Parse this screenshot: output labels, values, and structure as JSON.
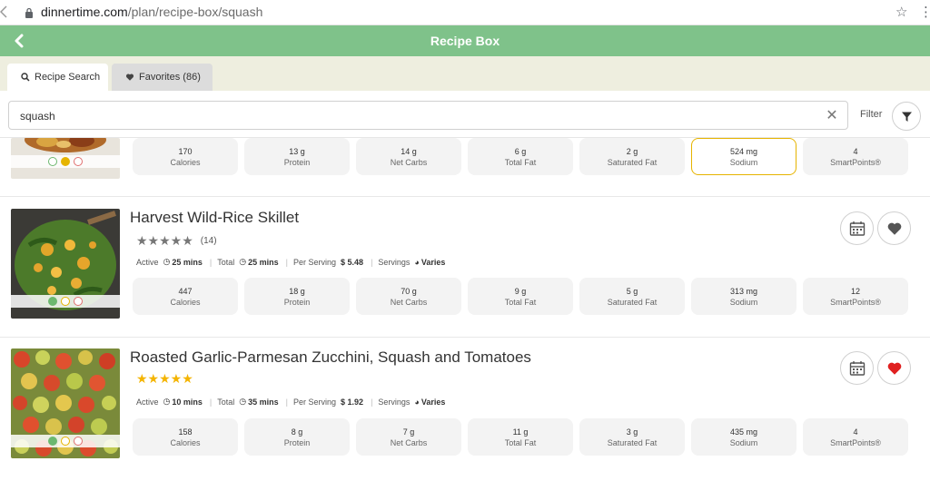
{
  "browser": {
    "url_host": "dinnertime.com",
    "url_path": "/plan/recipe-box/squash"
  },
  "header": {
    "title": "Recipe Box"
  },
  "tabs": [
    {
      "label": "Recipe Search",
      "icon": "search-icon",
      "active": true
    },
    {
      "label": "Favorites (86)",
      "icon": "heart-icon",
      "active": false
    }
  ],
  "search": {
    "value": "squash",
    "filter_label": "Filter"
  },
  "recipes": [
    {
      "partial": true,
      "indicators": [
        "green-outline",
        "yellow-filled",
        "red-outline"
      ],
      "nutrition": [
        {
          "value": "170",
          "label": "Calories"
        },
        {
          "value": "13 g",
          "label": "Protein"
        },
        {
          "value": "14 g",
          "label": "Net Carbs"
        },
        {
          "value": "6 g",
          "label": "Total Fat"
        },
        {
          "value": "2 g",
          "label": "Saturated Fat"
        },
        {
          "value": "524 mg",
          "label": "Sodium",
          "highlighted": true
        },
        {
          "value": "4",
          "label": "SmartPoints®"
        }
      ]
    },
    {
      "title": "Harvest Wild-Rice Skillet",
      "stars": "★★★★★",
      "rating_count": "(14)",
      "active_label": "Active",
      "active": "25 mins",
      "total_label": "Total",
      "total": "25 mins",
      "per_serving_label": "Per Serving",
      "per_serving": "$ 5.48",
      "servings_label": "Servings",
      "servings": "Varies",
      "favorited": false,
      "nutrition": [
        {
          "value": "447",
          "label": "Calories"
        },
        {
          "value": "18 g",
          "label": "Protein"
        },
        {
          "value": "70 g",
          "label": "Net Carbs"
        },
        {
          "value": "9 g",
          "label": "Total Fat"
        },
        {
          "value": "5 g",
          "label": "Saturated Fat"
        },
        {
          "value": "313 mg",
          "label": "Sodium"
        },
        {
          "value": "12",
          "label": "SmartPoints®"
        }
      ]
    },
    {
      "title": "Roasted Garlic-Parmesan Zucchini, Squash and Tomatoes",
      "stars": "★★★★★",
      "rating_count": "",
      "active_label": "Active",
      "active": "10 mins",
      "total_label": "Total",
      "total": "35 mins",
      "per_serving_label": "Per Serving",
      "per_serving": "$ 1.92",
      "servings_label": "Servings",
      "servings": "Varies",
      "favorited": true,
      "nutrition": [
        {
          "value": "158",
          "label": "Calories"
        },
        {
          "value": "8 g",
          "label": "Protein"
        },
        {
          "value": "7 g",
          "label": "Net Carbs"
        },
        {
          "value": "11 g",
          "label": "Total Fat"
        },
        {
          "value": "3 g",
          "label": "Saturated Fat"
        },
        {
          "value": "435 mg",
          "label": "Sodium"
        },
        {
          "value": "4",
          "label": "SmartPoints®"
        }
      ]
    }
  ],
  "colors": {
    "header_green": "#7fc28a",
    "tab_strip": "#eeeedf",
    "star_gold": "#f4b400",
    "heart_red": "#e02020",
    "highlight_border": "#e6b400"
  }
}
